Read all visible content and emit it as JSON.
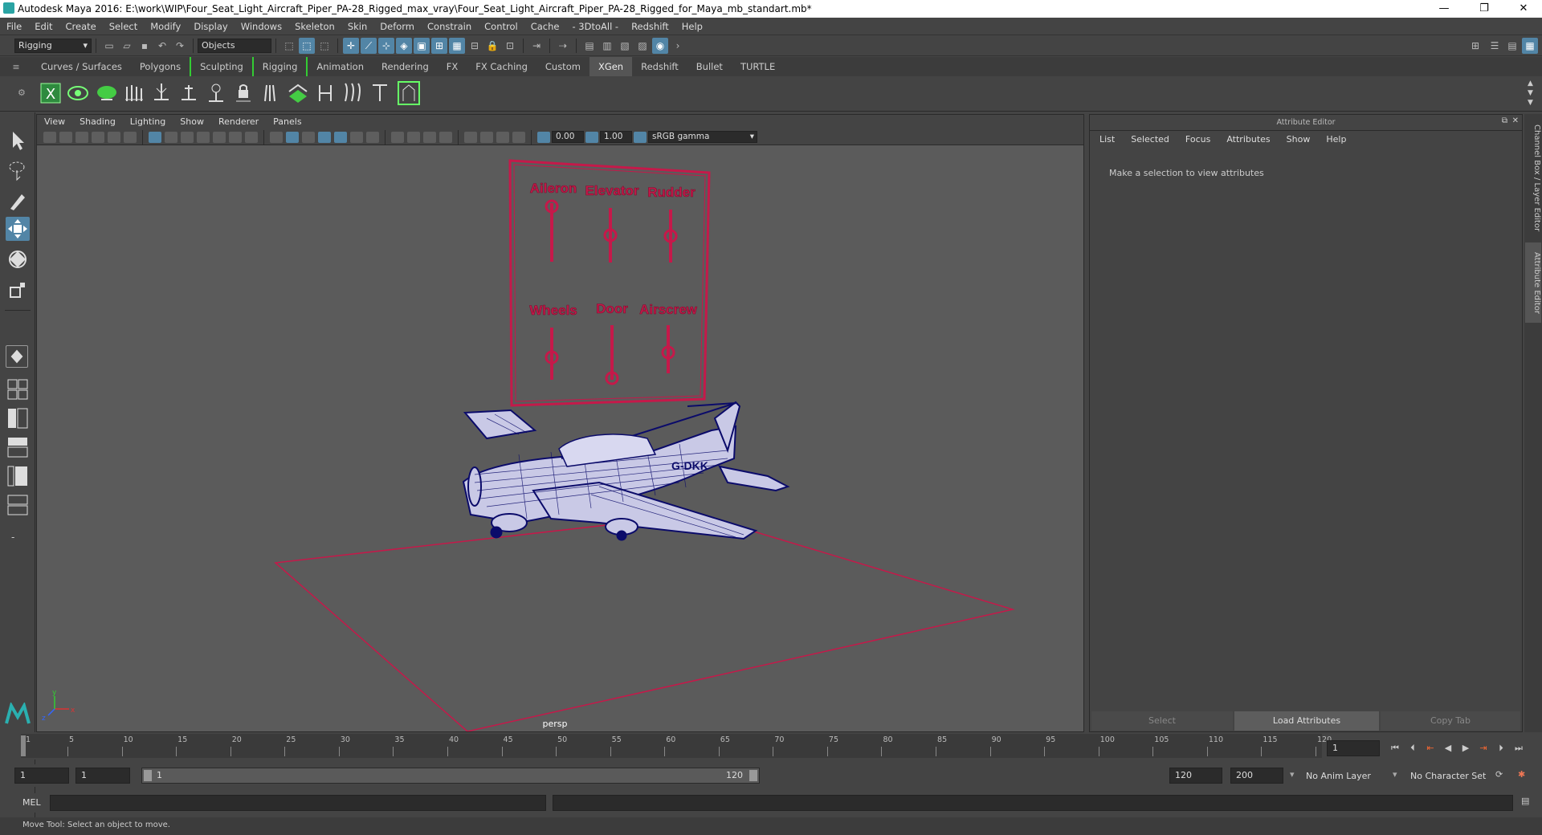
{
  "window": {
    "title": "Autodesk Maya 2016: E:\\work\\WIP\\Four_Seat_Light_Aircraft_Piper_PA-28_Rigged_max_vray\\Four_Seat_Light_Aircraft_Piper_PA-28_Rigged_for_Maya_mb_standart.mb*",
    "min": "—",
    "max": "❐",
    "close": "✕"
  },
  "menubar": [
    "File",
    "Edit",
    "Create",
    "Select",
    "Modify",
    "Display",
    "Windows",
    "Skeleton",
    "Skin",
    "Deform",
    "Constrain",
    "Control",
    "Cache",
    "- 3DtoAll -",
    "Redshift",
    "Help"
  ],
  "status": {
    "menuset": "Rigging",
    "selmode": "Objects"
  },
  "shelf_tabs": [
    "Curves / Surfaces",
    "Polygons",
    "Sculpting",
    "Rigging",
    "Animation",
    "Rendering",
    "FX",
    "FX Caching",
    "Custom",
    "XGen",
    "Redshift",
    "Bullet",
    "TURTLE"
  ],
  "shelf_active": "XGen",
  "viewport": {
    "menus": [
      "View",
      "Shading",
      "Lighting",
      "Show",
      "Renderer",
      "Panels"
    ],
    "near": "0.00",
    "far": "1.00",
    "colorspace": "sRGB gamma",
    "camera": "persp",
    "rig_labels": [
      "Aileron",
      "Elevator",
      "Rudder",
      "Wheels",
      "Door",
      "Airscrew"
    ],
    "tail_number": "G-DKK",
    "axis": {
      "x": "x",
      "y": "y",
      "z": "z"
    }
  },
  "attribute_editor": {
    "title": "Attribute Editor",
    "menus": [
      "List",
      "Selected",
      "Focus",
      "Attributes",
      "Show",
      "Help"
    ],
    "message": "Make a selection to view attributes",
    "buttons": [
      "Select",
      "Load Attributes",
      "Copy Tab"
    ]
  },
  "side_tabs": [
    "Channel Box / Layer Editor",
    "Attribute Editor"
  ],
  "timeline": {
    "ticks": [
      1,
      5,
      10,
      15,
      20,
      25,
      30,
      35,
      40,
      45,
      50,
      55,
      60,
      65,
      70,
      75,
      80,
      85,
      90,
      95,
      100,
      105,
      110,
      115,
      120
    ],
    "current_frame": "1"
  },
  "range": {
    "start": "1",
    "anim_start": "1",
    "slider_start": "1",
    "slider_end": "120",
    "anim_end": "120",
    "end": "200",
    "anim_layer": "No Anim Layer",
    "char_set": "No Character Set"
  },
  "cmdline": {
    "label": "MEL"
  },
  "helpline": {
    "text": "Move Tool: Select an object to move."
  }
}
